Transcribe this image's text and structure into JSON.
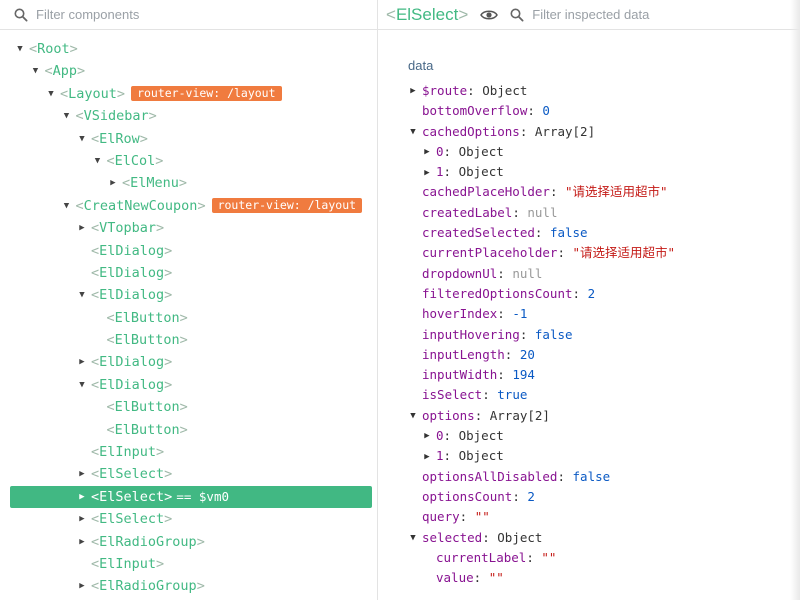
{
  "left_panel": {
    "filter_placeholder": "Filter components",
    "tree": [
      {
        "label": "Root",
        "depth": 0,
        "arrow": "down"
      },
      {
        "label": "App",
        "depth": 1,
        "arrow": "down"
      },
      {
        "label": "Layout",
        "depth": 2,
        "arrow": "down",
        "badge": "router-view: /layout"
      },
      {
        "label": "VSidebar",
        "depth": 3,
        "arrow": "down"
      },
      {
        "label": "ElRow",
        "depth": 4,
        "arrow": "down"
      },
      {
        "label": "ElCol",
        "depth": 5,
        "arrow": "down"
      },
      {
        "label": "ElMenu",
        "depth": 6,
        "arrow": "right"
      },
      {
        "label": "CreatNewCoupon",
        "depth": 3,
        "arrow": "down",
        "badge": "router-view: /layout"
      },
      {
        "label": "VTopbar",
        "depth": 4,
        "arrow": "right"
      },
      {
        "label": "ElDialog",
        "depth": 4,
        "arrow": "none"
      },
      {
        "label": "ElDialog",
        "depth": 4,
        "arrow": "none"
      },
      {
        "label": "ElDialog",
        "depth": 4,
        "arrow": "down"
      },
      {
        "label": "ElButton",
        "depth": 5,
        "arrow": "none"
      },
      {
        "label": "ElButton",
        "depth": 5,
        "arrow": "none"
      },
      {
        "label": "ElDialog",
        "depth": 4,
        "arrow": "right"
      },
      {
        "label": "ElDialog",
        "depth": 4,
        "arrow": "down"
      },
      {
        "label": "ElButton",
        "depth": 5,
        "arrow": "none"
      },
      {
        "label": "ElButton",
        "depth": 5,
        "arrow": "none"
      },
      {
        "label": "ElInput",
        "depth": 4,
        "arrow": "none"
      },
      {
        "label": "ElSelect",
        "depth": 4,
        "arrow": "right"
      },
      {
        "label": "ElSelect",
        "depth": 4,
        "arrow": "right",
        "selected": true,
        "vm": "== $vm0"
      },
      {
        "label": "ElSelect",
        "depth": 4,
        "arrow": "right"
      },
      {
        "label": "ElRadioGroup",
        "depth": 4,
        "arrow": "right"
      },
      {
        "label": "ElInput",
        "depth": 4,
        "arrow": "none"
      },
      {
        "label": "ElRadioGroup",
        "depth": 4,
        "arrow": "right"
      }
    ]
  },
  "right_panel": {
    "component_name": "ElSelect",
    "filter_placeholder": "Filter inspected data",
    "section_title": "data",
    "props": [
      {
        "key": "$route",
        "value": "Object",
        "type": "obj",
        "arrow": "right",
        "depth": 0
      },
      {
        "key": "bottomOverflow",
        "value": "0",
        "type": "num",
        "arrow": "none",
        "depth": 0
      },
      {
        "key": "cachedOptions",
        "value": "Array[2]",
        "type": "obj",
        "arrow": "down",
        "depth": 0
      },
      {
        "key": "0",
        "value": "Object",
        "type": "obj",
        "arrow": "right",
        "depth": 1
      },
      {
        "key": "1",
        "value": "Object",
        "type": "obj",
        "arrow": "right",
        "depth": 1
      },
      {
        "key": "cachedPlaceHolder",
        "value": "\"请选择适用超市\"",
        "type": "str",
        "arrow": "none",
        "depth": 0
      },
      {
        "key": "createdLabel",
        "value": "null",
        "type": "null",
        "arrow": "none",
        "depth": 0
      },
      {
        "key": "createdSelected",
        "value": "false",
        "type": "bool",
        "arrow": "none",
        "depth": 0
      },
      {
        "key": "currentPlaceholder",
        "value": "\"请选择适用超市\"",
        "type": "str",
        "arrow": "none",
        "depth": 0
      },
      {
        "key": "dropdownUl",
        "value": "null",
        "type": "null",
        "arrow": "none",
        "depth": 0
      },
      {
        "key": "filteredOptionsCount",
        "value": "2",
        "type": "num",
        "arrow": "none",
        "depth": 0
      },
      {
        "key": "hoverIndex",
        "value": "-1",
        "type": "num",
        "arrow": "none",
        "depth": 0
      },
      {
        "key": "inputHovering",
        "value": "false",
        "type": "bool",
        "arrow": "none",
        "depth": 0
      },
      {
        "key": "inputLength",
        "value": "20",
        "type": "num",
        "arrow": "none",
        "depth": 0
      },
      {
        "key": "inputWidth",
        "value": "194",
        "type": "num",
        "arrow": "none",
        "depth": 0
      },
      {
        "key": "isSelect",
        "value": "true",
        "type": "bool",
        "arrow": "none",
        "depth": 0
      },
      {
        "key": "options",
        "value": "Array[2]",
        "type": "obj",
        "arrow": "down",
        "depth": 0
      },
      {
        "key": "0",
        "value": "Object",
        "type": "obj",
        "arrow": "right",
        "depth": 1
      },
      {
        "key": "1",
        "value": "Object",
        "type": "obj",
        "arrow": "right",
        "depth": 1
      },
      {
        "key": "optionsAllDisabled",
        "value": "false",
        "type": "bool",
        "arrow": "none",
        "depth": 0
      },
      {
        "key": "optionsCount",
        "value": "2",
        "type": "num",
        "arrow": "none",
        "depth": 0
      },
      {
        "key": "query",
        "value": "\"\"",
        "type": "str",
        "arrow": "none",
        "depth": 0
      },
      {
        "key": "selected",
        "value": "Object",
        "type": "obj",
        "arrow": "down",
        "depth": 0
      },
      {
        "key": "currentLabel",
        "value": "\"\"",
        "type": "str",
        "arrow": "none",
        "depth": 1
      },
      {
        "key": "value",
        "value": "\"\"",
        "type": "str",
        "arrow": "none",
        "depth": 1
      }
    ]
  },
  "colors": {
    "vue_green": "#42b983",
    "selected_bg": "#41b883",
    "badge_orange": "#f07b3f",
    "key_purple": "#881391",
    "string_red": "#c41a16",
    "number_blue": "#0b5ac4"
  },
  "icons": {
    "search": "search-icon",
    "eye": "eye-icon",
    "expanded": "triangle-down-icon",
    "collapsed": "triangle-right-icon"
  }
}
